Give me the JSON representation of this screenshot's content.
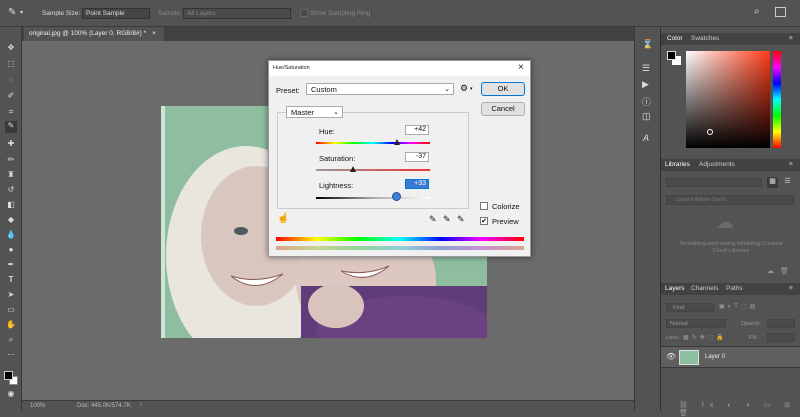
{
  "options_bar": {
    "sample_size_label": "Sample Size:",
    "sample_size_value": "Point Sample",
    "sample_label": "Sample:",
    "sample_value": "All Layers",
    "show_ring_label": "Show Sampling Ring"
  },
  "document_tab": {
    "label": "original.jpg @ 100% (Layer 0, RGB/8#) *",
    "close": "×"
  },
  "status": {
    "zoom": "100%",
    "doc": "Doc: 445.0K/574.7K"
  },
  "dialog": {
    "title": "Hue/Saturation",
    "close": "×",
    "preset_label": "Preset:",
    "preset_value": "Custom",
    "ok_label": "OK",
    "cancel_label": "Cancel",
    "channel_value": "Master",
    "hue_label": "Hue:",
    "hue_value": "+42",
    "saturation_label": "Saturation:",
    "saturation_value": "-37",
    "lightness_label": "Lightness:",
    "lightness_value": "+33",
    "colorize_label": "Colorize",
    "colorize_checked": false,
    "preview_label": "Preview",
    "preview_checked": true
  },
  "color_panel": {
    "tab_color": "Color",
    "tab_swatches": "Swatches"
  },
  "libraries_panel": {
    "tab_libraries": "Libraries",
    "tab_adjustments": "Adjustments",
    "search_placeholder": "Search Adobe Stock",
    "message": "Something went wrong initializing Creative Cloud Libraries"
  },
  "layers_panel": {
    "tab_layers": "Layers",
    "tab_channels": "Channels",
    "tab_paths": "Paths",
    "kind_label": "Kind",
    "blend_mode": "Normal",
    "opacity_label": "Opacity:",
    "lock_label": "Lock:",
    "fill_label": "Fill:",
    "layer_name": "Layer 0"
  },
  "colors": {
    "accent": "#0078d7",
    "panel_bg": "#535353",
    "canvas_bg": "#6b6b6b"
  }
}
